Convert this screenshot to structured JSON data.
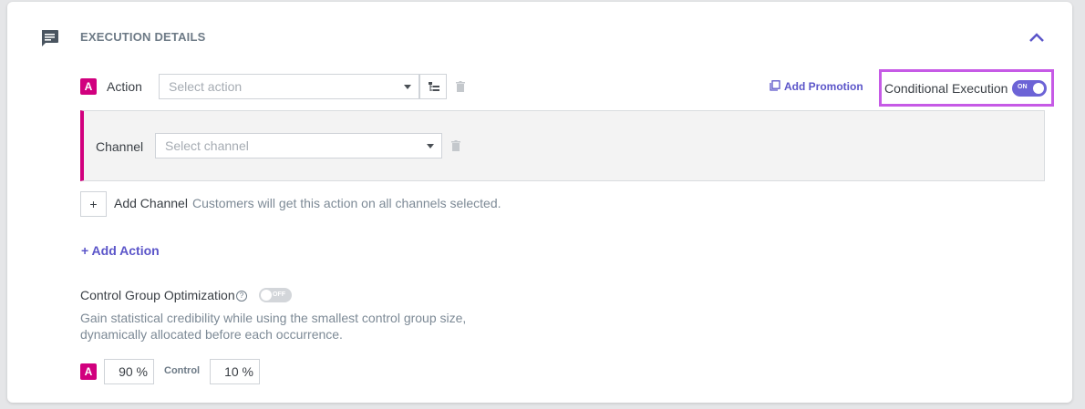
{
  "section": {
    "title": "EXECUTION DETAILS",
    "header_icon": "message-icon",
    "collapse_icon": "chevron-up-icon"
  },
  "action": {
    "badge": "A",
    "label": "Action",
    "select_placeholder": "Select action",
    "hierarchy_icon": "tree-icon",
    "delete_icon": "trash-icon"
  },
  "add_promotion": {
    "icon": "copy-icon",
    "label": "Add Promotion"
  },
  "conditional_execution": {
    "label": "Conditional Execution",
    "toggle_text": "ON",
    "enabled": true
  },
  "channel": {
    "label": "Channel",
    "select_placeholder": "Select channel",
    "delete_icon": "trash-icon"
  },
  "add_channel": {
    "plus": "+",
    "label": "Add Channel",
    "hint": "Customers will get this action on all channels selected."
  },
  "add_action": {
    "label": "+ Add Action"
  },
  "control_group": {
    "label": "Control Group Optimization",
    "help": "?",
    "toggle_text": "OFF",
    "enabled": false,
    "description_line1": "Gain statistical credibility while using the smallest control group size,",
    "description_line2": "dynamically allocated before each occurrence.",
    "variant_badge": "A",
    "variant_value": "90 %",
    "control_label": "Control",
    "control_value": "10 %"
  },
  "colors": {
    "accent": "#5b55c9",
    "badge": "#d1007e",
    "highlight": "#c65ae6",
    "toggle_on": "#6c63d6"
  }
}
